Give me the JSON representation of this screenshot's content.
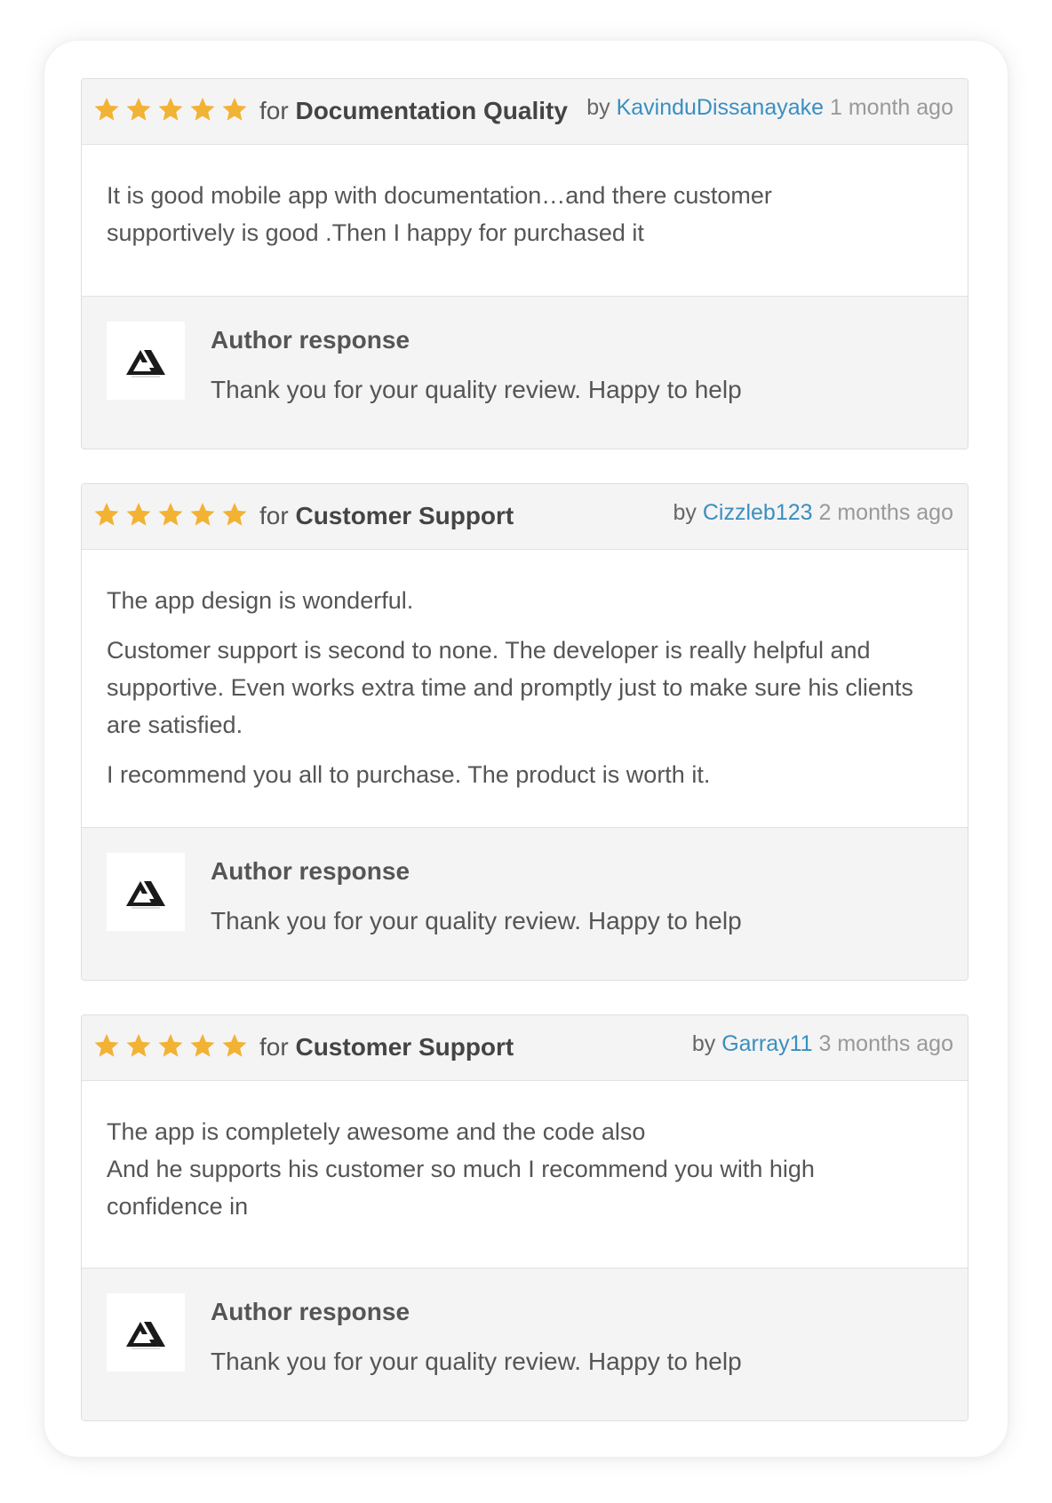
{
  "colors": {
    "star": "#f2b233",
    "username_link": "#3a8fc0",
    "timestamp": "#999999",
    "text": "#555555",
    "panel_bg": "#f4f4f4"
  },
  "reviews": [
    {
      "rating": 5,
      "for_label": "for",
      "category": "Documentation Quality",
      "by_label": "by",
      "username": "KavinduDissanayake",
      "time_ago": "1 month ago",
      "body": [
        "It is good mobile app with documentation…and there customer supportively is good .Then I happy for purchased it"
      ],
      "response": {
        "title": "Author response",
        "text": "Thank you for your quality review. Happy to help",
        "avatar_icon": "author-logo-icon"
      }
    },
    {
      "rating": 5,
      "for_label": "for",
      "category": "Customer Support",
      "by_label": "by",
      "username": "Cizzleb123",
      "time_ago": "2 months ago",
      "body": [
        "The app design is wonderful.",
        "Customer support is second to none. The developer is really helpful and supportive. Even works extra time and promptly just to make sure his clients are satisfied.",
        "I recommend you all to purchase. The product is worth it."
      ],
      "response": {
        "title": "Author response",
        "text": "Thank you for your quality review. Happy to help",
        "avatar_icon": "author-logo-icon"
      }
    },
    {
      "rating": 5,
      "for_label": "for",
      "category": "Customer Support",
      "by_label": "by",
      "username": "Garray11",
      "time_ago": "3 months ago",
      "body": [
        "The app is completely awesome and the code also",
        "And he supports his customer so much I recommend you with high confidence in"
      ],
      "response": {
        "title": "Author response",
        "text": "Thank you for your quality review. Happy to help",
        "avatar_icon": "author-logo-icon"
      }
    }
  ]
}
